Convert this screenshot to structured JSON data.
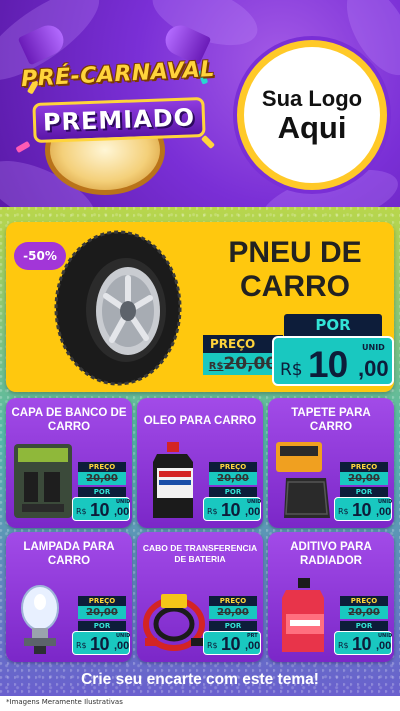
{
  "header": {
    "title_line1": "PRÉ-CARNAVAL",
    "title_line2": "PREMIADO",
    "logo_line1": "Sua Logo",
    "logo_line2": "Aqui"
  },
  "featured": {
    "discount": "-50%",
    "name_line1": "PNEU DE",
    "name_line2": "CARRO",
    "preco_label": "PREÇO",
    "old_price_prefix": "R$",
    "old_price": "20,00",
    "por_label": "POR",
    "currency": "R$",
    "price_int": "10",
    "price_dec": ",00",
    "unit": "UNID"
  },
  "products": [
    {
      "name": "CAPA DE BANCO DE CARRO",
      "preco_label": "PREÇO",
      "old_price": "20,00",
      "por_label": "POR",
      "currency": "R$",
      "price_int": "10",
      "price_dec": ",00",
      "unit": "UNID"
    },
    {
      "name": "OLEO PARA CARRO",
      "preco_label": "PREÇO",
      "old_price": "20,00",
      "por_label": "POR",
      "currency": "R$",
      "price_int": "10",
      "price_dec": ",00",
      "unit": "UNID"
    },
    {
      "name": "TAPETE PARA CARRO",
      "preco_label": "PREÇO",
      "old_price": "20,00",
      "por_label": "POR",
      "currency": "R$",
      "price_int": "10",
      "price_dec": ",00",
      "unit": "UNID"
    },
    {
      "name": "LAMPADA PARA CARRO",
      "preco_label": "PREÇO",
      "old_price": "20,00",
      "por_label": "POR",
      "currency": "R$",
      "price_int": "10",
      "price_dec": ",00",
      "unit": "UNID"
    },
    {
      "name": "CABO DE TRANSFERENCIA DE BATERIA",
      "preco_label": "PREÇO",
      "old_price": "20,00",
      "por_label": "POR",
      "currency": "R$",
      "price_int": "10",
      "price_dec": ",00",
      "unit": "PRT"
    },
    {
      "name": "ADITIVO PARA RADIADOR",
      "preco_label": "PREÇO",
      "old_price": "20,00",
      "por_label": "POR",
      "currency": "R$",
      "price_int": "10",
      "price_dec": ",00",
      "unit": "UNID"
    }
  ],
  "footer": {
    "cta": "Crie seu encarte com este tema!",
    "disclaimer": "*Imagens Meramente Ilustrativas"
  },
  "colors": {
    "purple": "#7b27c8",
    "yellow": "#ffc80e",
    "teal": "#19c8c0",
    "navy": "#0d1d3a"
  }
}
